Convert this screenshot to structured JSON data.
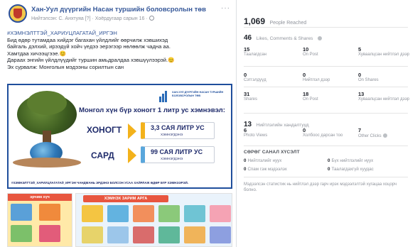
{
  "post": {
    "page_name": "Хан-Уул дүүргийн Насан туршийн боловсролын төв",
    "meta": "Нийтэлсэн: С. Анхтуяа [?] · Хоёрдугаар сарын 16 ·",
    "more_label": "···",
    "hashtag": "#ХЭМНЭЛТТЭЙ_ХАРИУЦЛАГАТАЙ_ИРГЭН",
    "lines": [
      "Бид өдөр тутамдаа хийдэг багахан үйлдлийг өөрчилж хэвшихэд",
      "байгаль дэлхий, ирээдүй хойч үедээ эерэгээр нөлөөлж чадна аа.",
      "Хамтдаа хичээцгээе.😊",
      "Дараах энгийн үйлдлүүдийг туршин амьдралдаа хэвшүүлээрэй.😊",
      "Эх сурвалж: Монголын мэдээны сорилтын сан"
    ],
    "infographic": {
      "logo_text": "ХАН-УУЛ ДҮҮРГИЙН НАСАН ТУРШИЙН БОЛОВСРОЛЫН ТӨВ",
      "title": "Монгол хүн бүр хоногт 1 литр ус хэмнэвэл:",
      "row1_label": "ХОНОГТ",
      "row1_value": "3,3 САЯ ЛИТР УС",
      "row1_sub": "ХЭМНЭГДЭНЭ",
      "row2_label": "САРД",
      "row2_value": "99 САЯ ЛИТР УС",
      "row2_sub": "ХЭМНЭГДЭНЭ",
      "footer": "#ХЭМНЭЛТТЭЙ_ХАРИУЦЛАГАТАЙ_ИРГЭН ЧАНДМАНЬ ЭРДЭНЭ БОЛСОН УСАА ХАЙРЛАЖ ӨДӨР БҮР ХЭМНЭЭРЭЙ."
    },
    "thumb_a_head": "эрчим хүч",
    "thumb_b_head": "ХЭМНЭХ ЗАРИМ АРГА"
  },
  "insights": {
    "reach_value": "1,069",
    "reach_label": "People Reached",
    "engagement_value": "46",
    "engagement_label": "Likes, Comments & Shares",
    "metrics": [
      {
        "value": "15",
        "label": "Таалагдсан"
      },
      {
        "value": "10",
        "label": "On Post"
      },
      {
        "value": "5",
        "label": "Хуваалцсан нийтлэл дээр"
      },
      {
        "value": "0",
        "label": "Сэтгэлдүүд"
      },
      {
        "value": "0",
        "label": "Нийтлэл дээр"
      },
      {
        "value": "0",
        "label": "On Shares"
      },
      {
        "value": "31",
        "label": "Shares"
      },
      {
        "value": "18",
        "label": "On Post"
      },
      {
        "value": "13",
        "label": "Хуваалцсан нийтлэл дээр"
      }
    ],
    "clicks_value": "13",
    "clicks_label": "Нийтлэлийн хандалтууд",
    "clicks": [
      {
        "value": "6",
        "label": "Photo Views"
      },
      {
        "value": "0",
        "label": "Холбоос дарсан тоо"
      },
      {
        "value": "7",
        "label": "Other Clicks"
      }
    ],
    "negative_title": "СӨРӨГ САНАЛ ХҮСЭЛТ",
    "negative": [
      {
        "value": "0",
        "label": "Нийтлэлийг нуух"
      },
      {
        "value": "0",
        "label": "Бүх нийтлэлийг нуух"
      },
      {
        "value": "0",
        "label": "Спам гэж мэдээлэх"
      },
      {
        "value": "0",
        "label": "Таалагдахгүй хуудас"
      }
    ],
    "note": "Мэдээлсэн статистик нь нийтлэл дээр гарч ирэх мэдээлэлтэй хугацаа хоцорч болно."
  }
}
